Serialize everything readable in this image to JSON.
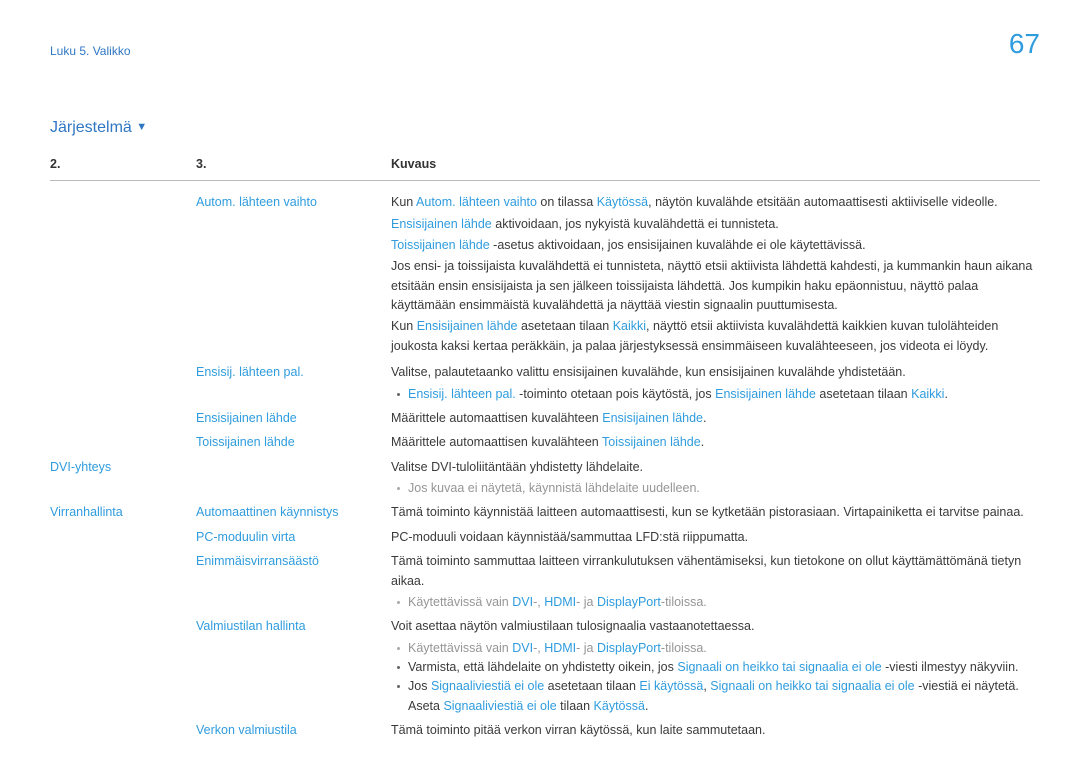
{
  "page_number": "67",
  "breadcrumb": "Luku 5. Valikko",
  "section_title": "Järjestelmä",
  "head2": "2.",
  "head3": "3.",
  "head_desc": "Kuvaus",
  "c1": {
    "dvi": "DVI-yhteys",
    "power": "Virranhallinta"
  },
  "c2": {
    "auto_src": "Autom. lähteen vaihto",
    "prim_restore": "Ensisij. lähteen pal.",
    "prim_src": "Ensisijainen lähde",
    "sec_src": "Toissijainen lähde",
    "auto_on": "Automaattinen käynnistys",
    "pc_module": "PC-moduulin virta",
    "max_save": "Enimmäisvirransäästö",
    "standby": "Valmiustilan hallinta",
    "net_standby": "Verkon valmiustila"
  },
  "t": {
    "auto1a": "Kun ",
    "auto1b": "Autom. lähteen vaihto",
    "auto1c": " on tilassa ",
    "auto1d": "Käytössä",
    "auto1e": ", näytön kuvalähde etsitään automaattisesti aktiiviselle videolle.",
    "auto2a": "Ensisijainen lähde",
    "auto2b": " aktivoidaan, jos nykyistä kuvalähdettä ei tunnisteta.",
    "auto3a": "Toissijainen lähde",
    "auto3b": " -asetus aktivoidaan, jos ensisijainen kuvalähde ei ole käytettävissä.",
    "auto4": "Jos ensi- ja toissijaista kuvalähdettä ei tunnisteta, näyttö etsii aktiivista lähdettä kahdesti, ja kummankin haun aikana etsitään ensin ensisijaista ja sen jälkeen toissijaista lähdettä. Jos kumpikin haku epäonnistuu, näyttö palaa käyttämään ensimmäistä kuvalähdettä ja näyttää viestin signaalin puuttumisesta.",
    "auto5a": "Kun ",
    "auto5b": "Ensisijainen lähde",
    "auto5c": " asetetaan tilaan ",
    "auto5d": "Kaikki",
    "auto5e": ", näyttö etsii aktiivista kuvalähdettä kaikkien kuvan tulolähteiden joukosta kaksi kertaa peräkkäin, ja palaa järjestyksessä ensimmäiseen kuvalähteeseen, jos videota ei löydy.",
    "pr1": "Valitse, palautetaanko valittu ensisijainen kuvalähde, kun ensisijainen kuvalähde yhdistetään.",
    "pr2a": "Ensisij. lähteen pal.",
    "pr2b": " -toiminto otetaan pois käytöstä, jos ",
    "pr2c": "Ensisijainen lähde",
    "pr2d": " asetetaan tilaan ",
    "pr2e": "Kaikki",
    "pr2f": ".",
    "ps1a": "Määrittele automaattisen kuvalähteen ",
    "ps1b": "Ensisijainen lähde",
    "ps1c": ".",
    "ss1a": "Määrittele automaattisen kuvalähteen ",
    "ss1b": "Toissijainen lähde",
    "ss1c": ".",
    "dvi1": "Valitse DVI-tuloliitäntään yhdistetty lähdelaite.",
    "dvi2": "Jos kuvaa ei näytetä, käynnistä lähdelaite uudelleen.",
    "ao": "Tämä toiminto käynnistää laitteen automaattisesti, kun se kytketään pistorasiaan. Virtapainiketta ei tarvitse painaa.",
    "pcm": "PC-moduuli voidaan käynnistää/sammuttaa LFD:stä riippumatta.",
    "mps": "Tämä toiminto sammuttaa laitteen virrankulutuksen vähentämiseksi, kun tietokone on ollut käyttämättömänä tietyn aikaa.",
    "avail_a": "Käytettävissä vain ",
    "dvi_": "DVI",
    "hdmi_": "HDMI",
    "dp_": "DisplayPort",
    "dash": "-",
    "comma_sp": ", ",
    "ja": "- ja ",
    "til": "-tiloissa.",
    "sb1": "Voit asettaa näytön valmiustilaan tulosignaalia vastaanotettaessa.",
    "sb2a": "Varmista, että lähdelaite on yhdistetty oikein, jos ",
    "sb2b": "Signaali on heikko tai signaalia ei ole",
    "sb2c": " -viesti ilmestyy näkyviin.",
    "sb3a": "Jos ",
    "sb3b": "Signaaliviestiä ei ole",
    "sb3c": " asetetaan tilaan ",
    "sb3d": "Ei käytössä",
    "sb3e": ", ",
    "sb3f": "Signaali on heikko tai signaalia ei ole",
    "sb3g": " -viestiä ei näytetä.",
    "sb4a": "Aseta ",
    "sb4b": "Signaaliviestiä ei ole",
    "sb4c": " tilaan ",
    "sb4d": "Käytössä",
    "sb4e": ".",
    "ns": "Tämä toiminto pitää verkon virran käytössä, kun laite sammutetaan."
  }
}
